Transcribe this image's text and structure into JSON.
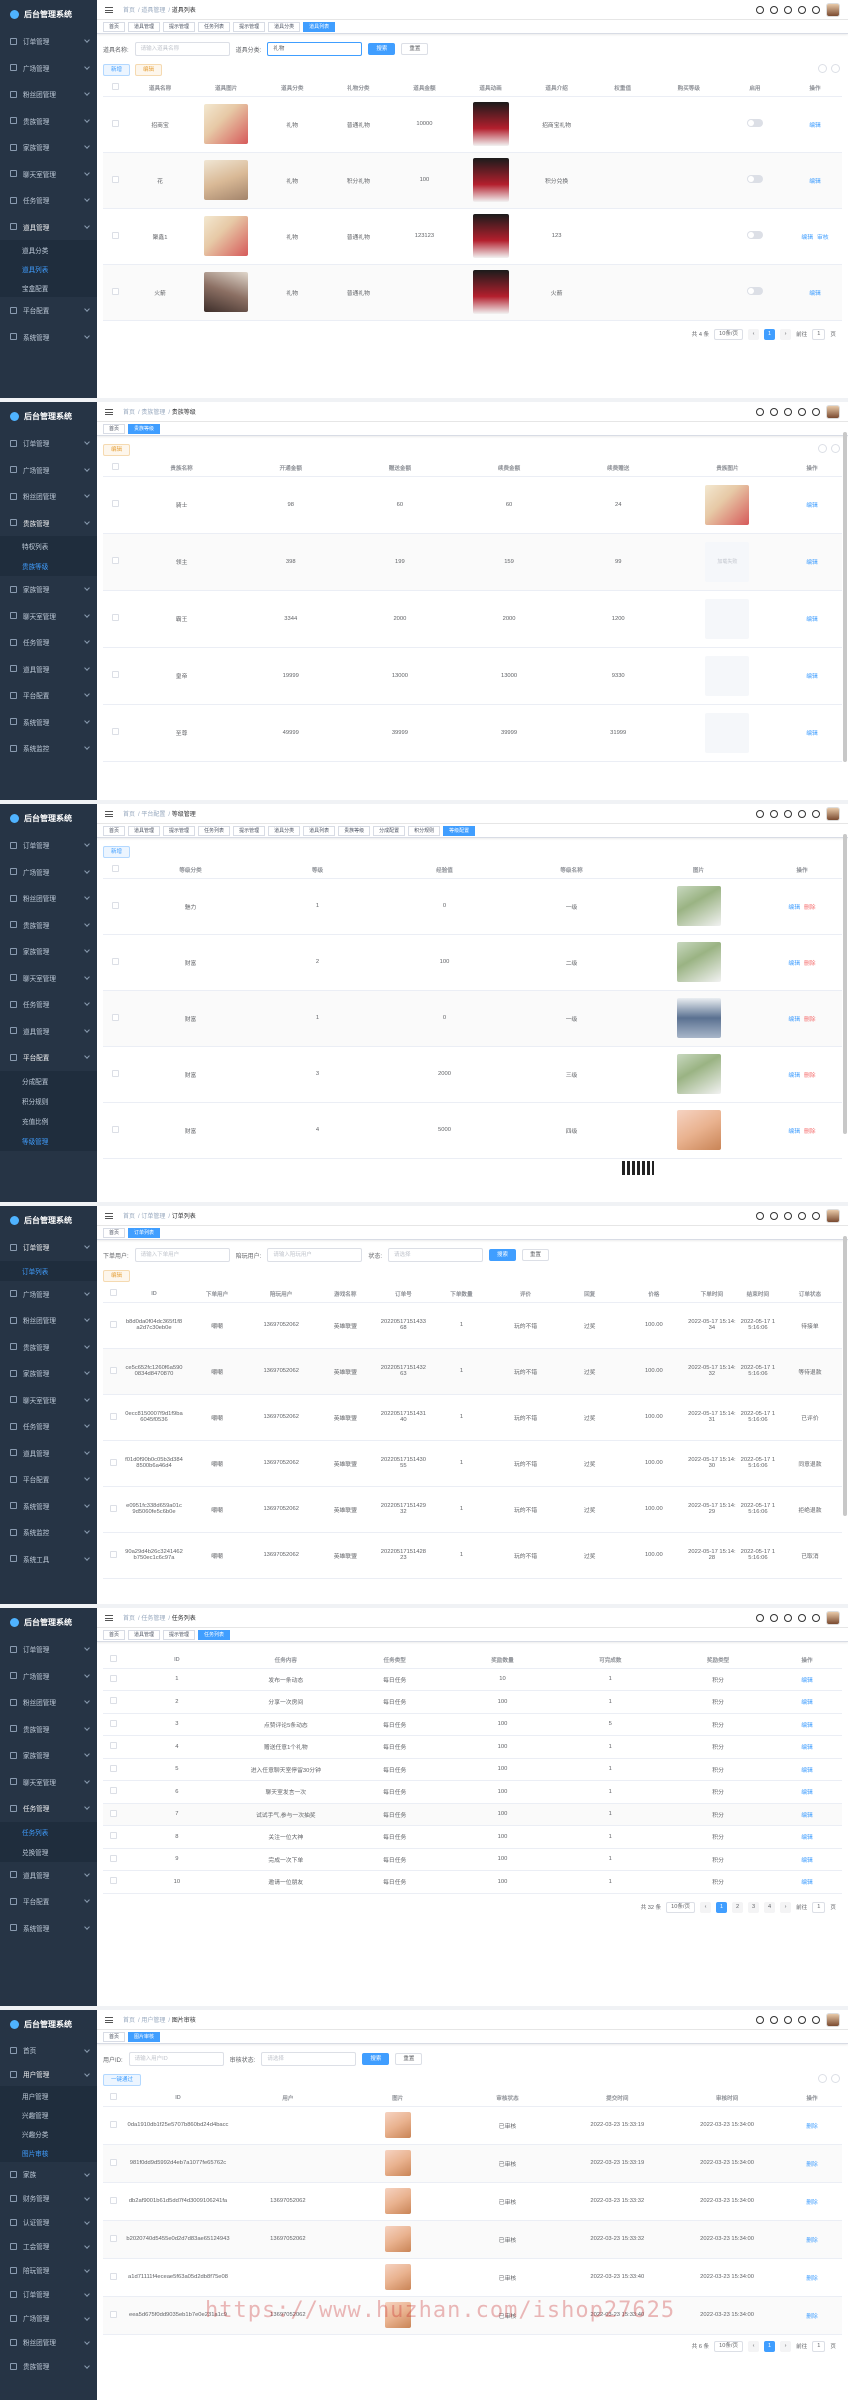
{
  "app": {
    "logo_text": "后台管理系统"
  },
  "common": {
    "home": "首页",
    "search": "搜索",
    "reset": "重置",
    "add": "新增",
    "delete": "删除",
    "edit": "编辑",
    "remove": "删除",
    "audit": "审核",
    "batch_audit": "一键通过",
    "placeholder_input": "请输入",
    "total_label": "共",
    "per_page": "10条/页",
    "goto": "前往",
    "page_unit": "页"
  },
  "panel1": {
    "crumbs": [
      "首页",
      "道具管理",
      "道具列表"
    ],
    "tabs": [
      "首页",
      "道具管理",
      "提示管理",
      "任务列表",
      "提示管理",
      "道具分类",
      "道具列表"
    ],
    "filter": {
      "name_label": "道具名称:",
      "name_placeholder": "请输入道具名称",
      "cat_label": "道具分类:",
      "cat_value": "礼物"
    },
    "columns": [
      "道具名称",
      "道具图片",
      "道具分类",
      "礼物分类",
      "道具金额",
      "道具动画",
      "道具介绍",
      "权重值",
      "购买等级",
      "启用",
      "操作"
    ],
    "rows": [
      {
        "name": "招商宝",
        "cat": "礼物",
        "gift": "普通礼物",
        "amount": "10000",
        "intro": "招商宝礼物",
        "weight": "",
        "level": ""
      },
      {
        "name": "花",
        "cat": "礼物",
        "gift": "积分礼物",
        "amount": "100",
        "intro": "积分兑换",
        "weight": "",
        "level": ""
      },
      {
        "name": "聚鑫1",
        "cat": "礼物",
        "gift": "普通礼物",
        "amount": "123123",
        "intro": "123",
        "weight": "",
        "level": ""
      },
      {
        "name": "火箭",
        "cat": "礼物",
        "gift": "普通礼物",
        "amount": "",
        "intro": "火箭",
        "weight": "",
        "level": ""
      }
    ],
    "pagination": {
      "total": "共 4 条",
      "page": "1",
      "goto_val": "1"
    }
  },
  "panel2": {
    "crumbs": [
      "首页",
      "贵族管理",
      "贵族等级"
    ],
    "tabs": [
      "首页",
      "贵族等级"
    ],
    "columns": [
      "贵族名称",
      "开通金额",
      "赠送金额",
      "续费金额",
      "续费赠送",
      "贵族图片",
      "操作"
    ],
    "rows": [
      {
        "name": "骑士",
        "open": "98",
        "gift": "60",
        "renew": "60",
        "renew_gift": "24",
        "img": "img"
      },
      {
        "name": "领主",
        "open": "398",
        "gift": "199",
        "renew": "159",
        "renew_gift": "99",
        "img": "加载失败"
      },
      {
        "name": "霸王",
        "open": "3344",
        "gift": "2000",
        "renew": "2000",
        "renew_gift": "1200",
        "img": "blank"
      },
      {
        "name": "皇帝",
        "open": "19999",
        "gift": "13000",
        "renew": "13000",
        "renew_gift": "9330",
        "img": "blank"
      },
      {
        "name": "至尊",
        "open": "49999",
        "gift": "39999",
        "renew": "39999",
        "renew_gift": "31999",
        "img": "blank"
      }
    ]
  },
  "panel3": {
    "crumbs": [
      "首页",
      "平台配置",
      "等级管理"
    ],
    "tabs": [
      "首页",
      "道具管理",
      "提示管理",
      "任务列表",
      "提示管理",
      "道具分类",
      "道具列表",
      "贵族等级",
      "分成配置",
      "积分规则",
      "等级配置"
    ],
    "columns": [
      "等级分类",
      "等级",
      "经验值",
      "等级名称",
      "图片",
      "操作"
    ],
    "rows": [
      {
        "cat": "魅力",
        "level": "1",
        "exp": "0",
        "name": "一级"
      },
      {
        "cat": "财富",
        "level": "2",
        "exp": "100",
        "name": "二级"
      },
      {
        "cat": "财富",
        "level": "1",
        "exp": "0",
        "name": "一级"
      },
      {
        "cat": "财富",
        "level": "3",
        "exp": "2000",
        "name": "三级"
      },
      {
        "cat": "财富",
        "level": "4",
        "exp": "5000",
        "name": "四级"
      }
    ]
  },
  "panel4": {
    "crumbs": [
      "首页",
      "订单管理",
      "订单列表"
    ],
    "tabs": [
      "首页",
      "订单列表"
    ],
    "filter": {
      "user_label": "下单用户:",
      "user_ph": "请输入下单用户",
      "partner_label": "陪玩用户:",
      "partner_ph": "请输入陪玩用户",
      "status_label": "状态:",
      "status_ph": "请选择"
    },
    "columns": [
      "ID",
      "下单用户",
      "陪玩用户",
      "游戏名称",
      "订单号",
      "下单数量",
      "评价",
      "回复",
      "价格",
      "下单时间",
      "结束时间",
      "订单状态"
    ],
    "rows": [
      {
        "id": "b8d0da0f04dc365f1f8a2d7c30eb0e",
        "user": "嘲嘲",
        "partner": "13697052062",
        "game": "英雄联盟",
        "order": "2022051715143368",
        "qty": "1",
        "eval": "玩的不错",
        "reply": "过奖",
        "price": "100.00",
        "start": "2022-05-17 15:14:34",
        "end": "2022-05-17 15:16:06",
        "status": "待接单"
      },
      {
        "id": "ce5c652fc1260f6a5900834d8470870",
        "user": "嘲嘲",
        "partner": "13697052062",
        "game": "英雄联盟",
        "order": "2022051715143263",
        "qty": "1",
        "eval": "玩的不错",
        "reply": "过奖",
        "price": "100.00",
        "start": "2022-05-17 15:14:32",
        "end": "2022-05-17 15:16:06",
        "status": "等待退款"
      },
      {
        "id": "0ecc8150007f9d1f9ba6045f0536",
        "user": "嘲嘲",
        "partner": "13697052062",
        "game": "英雄联盟",
        "order": "2022051715143140",
        "qty": "1",
        "eval": "玩的不错",
        "reply": "过奖",
        "price": "100.00",
        "start": "2022-05-17 15:14:31",
        "end": "2022-05-17 15:16:06",
        "status": "已评价"
      },
      {
        "id": "f01d0f90b0c05b3d3848500b6a46d4",
        "user": "嘲嘲",
        "partner": "13697052062",
        "game": "英雄联盟",
        "order": "2022051715143055",
        "qty": "1",
        "eval": "玩的不错",
        "reply": "过奖",
        "price": "100.00",
        "start": "2022-05-17 15:14:30",
        "end": "2022-05-17 15:16:06",
        "status": "同意退款"
      },
      {
        "id": "e0951fc338d659a01c9d5060fe5c6b0e",
        "user": "嘲嘲",
        "partner": "13697052062",
        "game": "英雄联盟",
        "order": "2022051715142932",
        "qty": "1",
        "eval": "玩的不错",
        "reply": "过奖",
        "price": "100.00",
        "start": "2022-05-17 15:14:29",
        "end": "2022-05-17 15:16:06",
        "status": "拒绝退款"
      },
      {
        "id": "90a29d4b26c3241462b750ec1c6c97a",
        "user": "嘲嘲",
        "partner": "13697052062",
        "game": "英雄联盟",
        "order": "2022051715142823",
        "qty": "1",
        "eval": "玩的不错",
        "reply": "过奖",
        "price": "100.00",
        "start": "2022-05-17 15:14:28",
        "end": "2022-05-17 15:16:06",
        "status": "已取消"
      }
    ]
  },
  "panel5": {
    "crumbs": [
      "首页",
      "任务管理",
      "任务列表"
    ],
    "tabs": [
      "首页",
      "道具管理",
      "提示管理",
      "任务列表"
    ],
    "columns": [
      "ID",
      "任务内容",
      "任务类型",
      "奖励数量",
      "可完成数",
      "奖励类型",
      "操作"
    ],
    "rows": [
      {
        "id": "1",
        "content": "发布一条动态",
        "type": "每日任务",
        "reward": "10",
        "times": "1",
        "rtype": "积分"
      },
      {
        "id": "2",
        "content": "分享一次房间",
        "type": "每日任务",
        "reward": "100",
        "times": "1",
        "rtype": "积分"
      },
      {
        "id": "3",
        "content": "点赞评论5条动态",
        "type": "每日任务",
        "reward": "100",
        "times": "5",
        "rtype": "积分"
      },
      {
        "id": "4",
        "content": "赠送任意1个礼物",
        "type": "每日任务",
        "reward": "100",
        "times": "1",
        "rtype": "积分"
      },
      {
        "id": "5",
        "content": "进入任意聊天室停留30分钟",
        "type": "每日任务",
        "reward": "100",
        "times": "1",
        "rtype": "积分"
      },
      {
        "id": "6",
        "content": "聊天室发言一次",
        "type": "每日任务",
        "reward": "100",
        "times": "1",
        "rtype": "积分"
      },
      {
        "id": "7",
        "content": "试试手气,参与一次抽奖",
        "type": "每日任务",
        "reward": "100",
        "times": "1",
        "rtype": "积分"
      },
      {
        "id": "8",
        "content": "关注一位大神",
        "type": "每日任务",
        "reward": "100",
        "times": "1",
        "rtype": "积分"
      },
      {
        "id": "9",
        "content": "完成一次下单",
        "type": "每日任务",
        "reward": "100",
        "times": "1",
        "rtype": "积分"
      },
      {
        "id": "10",
        "content": "邀请一位朋友",
        "type": "每日任务",
        "reward": "100",
        "times": "1",
        "rtype": "积分"
      }
    ],
    "pagination": {
      "total": "共 32 条",
      "pages": [
        "1",
        "2",
        "3",
        "4"
      ],
      "goto_val": "1"
    }
  },
  "panel6": {
    "crumbs": [
      "首页",
      "用户管理",
      "图片审核"
    ],
    "tabs": [
      "首页",
      "图片审核"
    ],
    "filter": {
      "user_label": "用户ID:",
      "user_ph": "请输入用户ID",
      "status_label": "审核状态:",
      "status_ph": "请选择"
    },
    "columns": [
      "ID",
      "用户",
      "图片",
      "审核状态",
      "提交时间",
      "审核时间",
      "操作"
    ],
    "rows": [
      {
        "id": "0da1910db1f25e5707b860bd24d4bacc",
        "user": "",
        "status": "已审核",
        "submit": "2022-03-23 15:33:19",
        "audit": "2022-03-23 15:34:00"
      },
      {
        "id": "981f0dd9d5992d4eb7a1077fe65762c",
        "user": "",
        "status": "已审核",
        "submit": "2022-03-23 15:33:19",
        "audit": "2022-03-23 15:34:00"
      },
      {
        "id": "db2af9001b61d5dd7f4d3009106241fa",
        "user": "13697052062",
        "status": "已审核",
        "submit": "2022-03-23 15:33:32",
        "audit": "2022-03-23 15:34:00"
      },
      {
        "id": "b2020740d5455e0d2d7d83ae65124943",
        "user": "13697052062",
        "status": "已审核",
        "submit": "2022-03-23 15:33:32",
        "audit": "2022-03-23 15:34:00"
      },
      {
        "id": "a1d71111f4eceae5f63a05d2db8f75e08",
        "user": "",
        "status": "已审核",
        "submit": "2022-03-23 15:33:40",
        "audit": "2022-03-23 15:34:00"
      },
      {
        "id": "eea5d675f0dd9035eb1b7e0e231a1c9",
        "user": "13697052062",
        "status": "已审核",
        "submit": "2022-03-23 15:33:40",
        "audit": "2022-03-23 15:34:00"
      }
    ],
    "pagination": {
      "total": "共 6 条",
      "page": "1",
      "goto_val": "1"
    }
  },
  "sidebar": {
    "p1": [
      "订单管理",
      "广场管理",
      "粉丝团管理",
      "贵族管理",
      "家族管理",
      "聊天室管理",
      "任务管理",
      "道具管理",
      "道具分类",
      "道具列表",
      "宝盒配置",
      "平台配置",
      "系统管理"
    ],
    "p2": [
      "订单管理",
      "广场管理",
      "粉丝团管理",
      "贵族管理",
      "特权列表",
      "贵族等级",
      "家族管理",
      "聊天室管理",
      "任务管理",
      "道具管理",
      "平台配置",
      "系统管理",
      "系统监控"
    ],
    "p3": [
      "订单管理",
      "广场管理",
      "粉丝团管理",
      "贵族管理",
      "家族管理",
      "聊天室管理",
      "任务管理",
      "道具管理",
      "平台配置",
      "分成配置",
      "积分规则",
      "充值比例",
      "等级管理"
    ],
    "p4": [
      "订单管理",
      "订单列表",
      "广场管理",
      "粉丝团管理",
      "贵族管理",
      "家族管理",
      "聊天室管理",
      "任务管理",
      "道具管理",
      "平台配置",
      "系统管理",
      "系统监控",
      "系统工具"
    ],
    "p5": [
      "订单管理",
      "广场管理",
      "粉丝团管理",
      "贵族管理",
      "家族管理",
      "聊天室管理",
      "任务管理",
      "任务列表",
      "兑换管理",
      "道具管理",
      "平台配置",
      "系统管理"
    ],
    "p6": [
      "首页",
      "用户管理",
      "用户管理",
      "兴趣管理",
      "兴趣分类",
      "图片审核",
      "家族",
      "财务管理",
      "认证管理",
      "工会管理",
      "陪玩管理",
      "订单管理",
      "广场管理",
      "粉丝团管理",
      "贵族管理"
    ]
  },
  "watermark": "https://www.huzhan.com/ishop27625"
}
